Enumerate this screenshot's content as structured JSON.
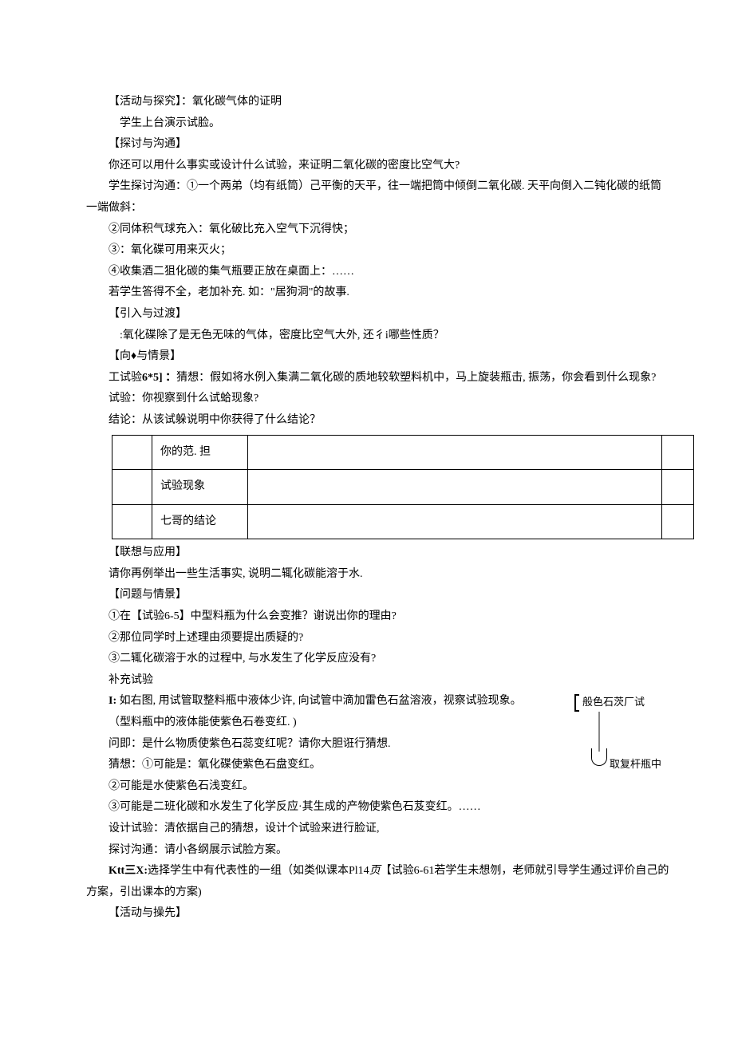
{
  "p1": "【活动与探究】：氧化碳气体的证明",
  "p2": "学生上台演示试脸。",
  "p3": "【探讨与沟通】",
  "p4": "你还可以用什么事实或设计什么试验，来证明二氧化碳的密度比空气大?",
  "p5": "学生探讨沟通：①一个两弟（均有纸筒）己平衡的天平，往一端把筒中倾倒二氧化碳. 天平向倒入二钝化碳的纸筒一端做斜：",
  "p6": "②同体积气球充入：氧化破比充入空气下沉得快；",
  "p7": "③：氧化碟可用来灭火；",
  "p8": "④收集酒二狙化碳的集气瓶要正放在桌面上：……",
  "p9": "若学生答得不全，老加补充. 如：\"居狗洞\"的故事.",
  "p10": "【引入与过渡】",
  "p11": ":氧化碟除了是无色无味的气体，密度比空气大外, 还彳i哪些性质？",
  "p12": "【向♦与情景】",
  "p13_prefix": "工试验",
  "p13_bold": "6*5] ：",
  "p13_rest": "猜想：假如将水例入集满二氧化碳的质地较软塑料机中，马上旋装瓶击, 振荡，你会看到什么现象?",
  "p14": "试验：你视察到什么试蛤现象?",
  "p15": "结论：从该试躲说明中你获得了什么结论？",
  "table": {
    "r1": "你的范. 担",
    "r2": "试验现象",
    "r3": "七哥的结论"
  },
  "p16": "【联想与应用】",
  "p17": "请你再例举出一些生活事实, 说明二辄化碳能溶于水.",
  "p18": "【问题与情景】",
  "p19": "①在【试验6-5】中型料瓶为什么会变推？谢说出你的理由?",
  "p20": "②那位同学时上述理由须要提出质疑的?",
  "p21": "③二辄化碳溶于水的过程中, 与水发生了化学反应没有?",
  "p22": "补充试验",
  "p23_prefix": "I: ",
  "p23_rest": "如右图, 用试管取整料瓶中液体少许, 向试管中滴加雷色石盆溶液，视察试验现象。",
  "diagram": {
    "top": "般色石茨厂试",
    "bottom": "取复杆瓶中"
  },
  "p24": "（型料瓶中的液体能使紫色石卷变红. )",
  "p25": "问即：是什么物质使紫色石蕊变红呢？请你大胆诳行猜想.",
  "p26": "猜想：①可能是：氧化碟使紫色石盘变红。",
  "p27": "②可能是水使紫色石浅变红。",
  "p28": "③可能是二班化碳和水发生了化学反应·其生成的产物使紫色石芨变红。……",
  "p29": "设计试验：清依据自己的猜想，设计个试验来进行脸证,",
  "p30": "探讨沟通：请小各纲展示试脸方案。",
  "p31_bold": "Ktt三X:",
  "p31_rest": "选择学生中有代表性的一组（如类似课本Pl14",
  "p31_italic": "页",
  "p31_after": "【试验6-61若学生未想刎，老师就引导学生通过评价自己的方案，引出课本的方案)",
  "p32": "【活动与操先】"
}
